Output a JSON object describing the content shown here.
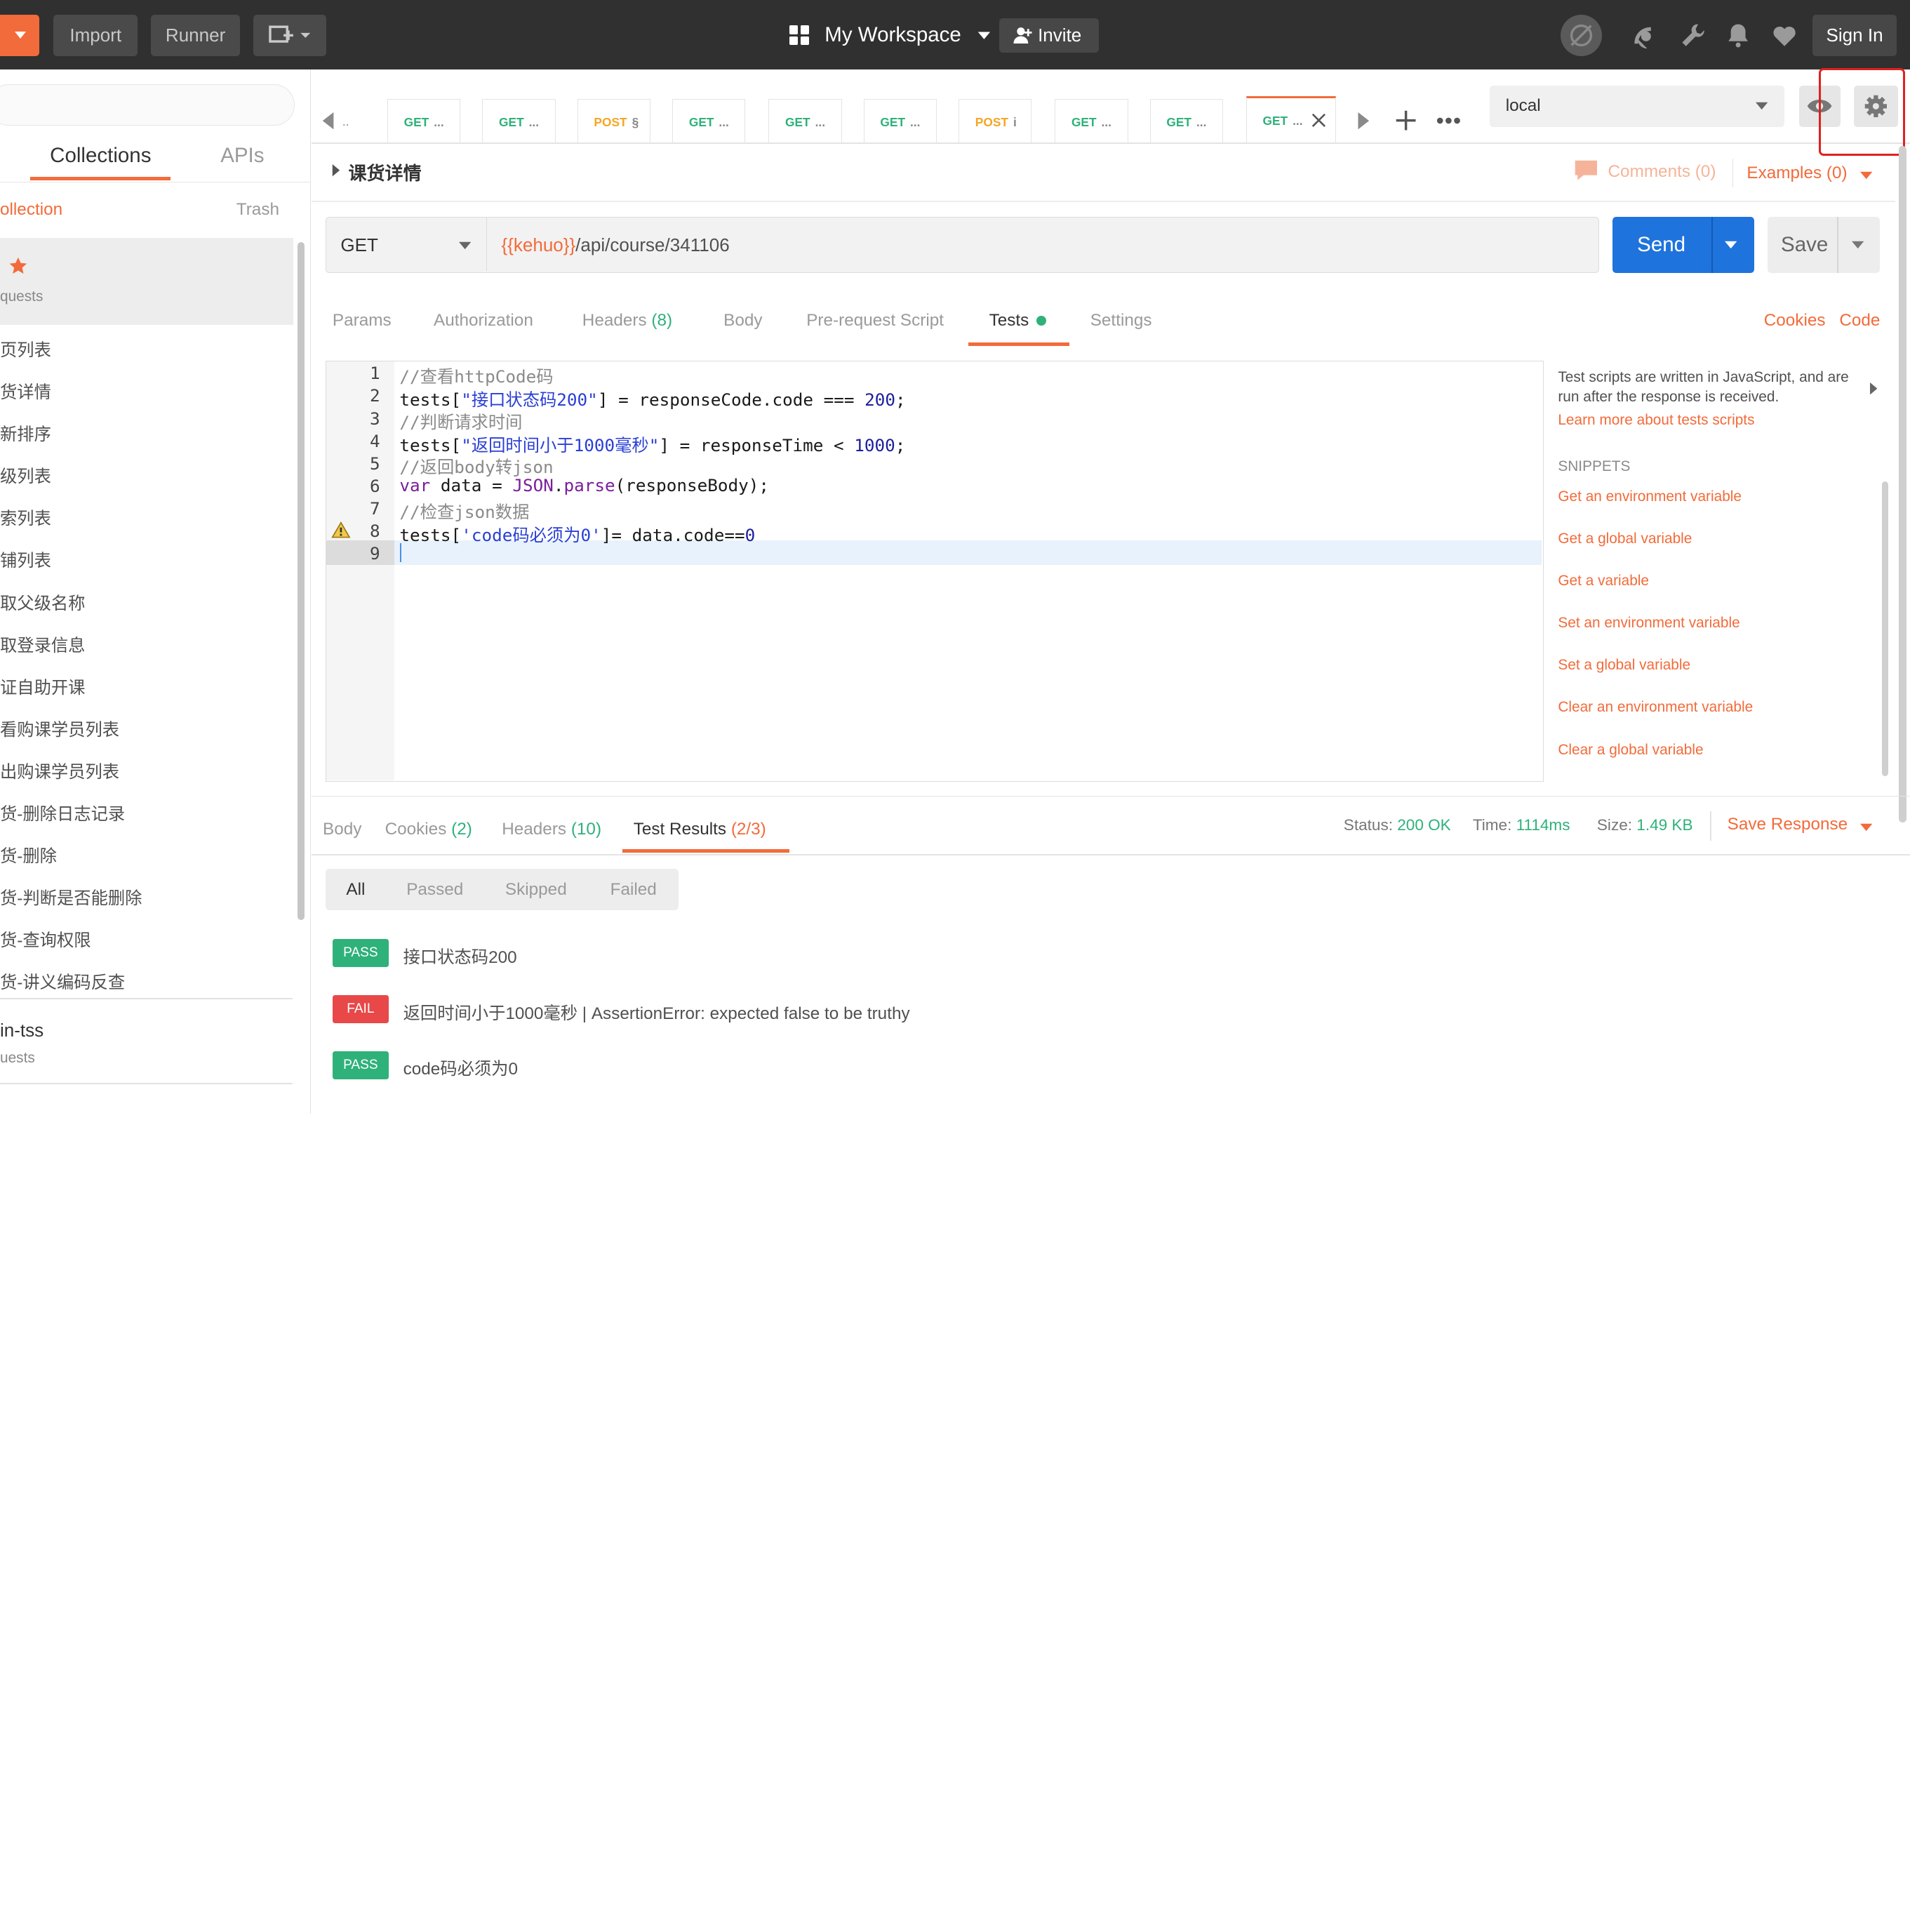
{
  "topbar": {
    "import_label": "Import",
    "runner_label": "Runner",
    "workspace_label": "My Workspace",
    "invite_label": "Invite",
    "signin_label": "Sign In"
  },
  "sidebar": {
    "tabs": [
      "Collections",
      "APIs"
    ],
    "new_collection_label": "ollection",
    "trash_label": "Trash",
    "favorite_sub": "quests",
    "items": [
      "页列表",
      "货详情",
      "新排序",
      "级列表",
      "索列表",
      "铺列表",
      "取父级名称",
      "取登录信息",
      "证自助开课",
      "看购课学员列表",
      "出购课学员列表",
      "货-删除日志记录",
      "货-删除",
      "货-判断是否能删除",
      "货-查询权限",
      "货-讲义编码反查"
    ],
    "group2_title": "in-tss",
    "group2_sub": "uests"
  },
  "tabs": [
    {
      "method": "GET",
      "label": "..."
    },
    {
      "method": "GET",
      "label": "..."
    },
    {
      "method": "POST",
      "label": "§"
    },
    {
      "method": "GET",
      "label": "..."
    },
    {
      "method": "GET",
      "label": "..."
    },
    {
      "method": "GET",
      "label": "..."
    },
    {
      "method": "POST",
      "label": "i"
    },
    {
      "method": "GET",
      "label": "..."
    },
    {
      "method": "GET",
      "label": "..."
    },
    {
      "method": "GET",
      "label": "..."
    }
  ],
  "first_tab_label": "..",
  "environment": {
    "selected": "local"
  },
  "request": {
    "name": "课货详情",
    "comments_label": "Comments (0)",
    "examples_label": "Examples (0)",
    "method": "GET",
    "url_var": "{{kehuo}}",
    "url_path": "/api/course/341106",
    "send_label": "Send",
    "save_label": "Save",
    "tabs": {
      "params": "Params",
      "authorization": "Authorization",
      "headers": "Headers",
      "headers_count": "(8)",
      "body": "Body",
      "prerequest": "Pre-request Script",
      "tests": "Tests",
      "settings": "Settings"
    },
    "cookies_label": "Cookies",
    "code_label": "Code"
  },
  "editor": {
    "lines": [
      "1",
      "2",
      "3",
      "4",
      "5",
      "6",
      "7",
      "8",
      "9"
    ],
    "code": {
      "l1": "//查看httpCode码",
      "l2a": "tests[",
      "l2b": "\"接口状态码200\"",
      "l2c": "] = responseCode.code === ",
      "l2d": "200",
      "l2e": ";",
      "l3": "//判断请求时间",
      "l4a": "tests[",
      "l4b": "\"返回时间小于1000毫秒\"",
      "l4c": "] = responseTime < ",
      "l4d": "1000",
      "l4e": ";",
      "l5": "//返回body转json",
      "l6a": "var",
      "l6b": " data = ",
      "l6c": "JSON",
      "l6d": ".",
      "l6e": "parse",
      "l6f": "(responseBody);",
      "l7": "//检查json数据",
      "l8a": "tests[",
      "l8b": "'code码必须为0'",
      "l8c": "]= data.code==",
      "l8d": "0"
    }
  },
  "snippets_panel": {
    "info": "Test scripts are written in JavaScript, and are run after the response is received.",
    "learn_more": "Learn more about tests scripts",
    "heading": "SNIPPETS",
    "items": [
      "Get an environment variable",
      "Get a global variable",
      "Get a variable",
      "Set an environment variable",
      "Set a global variable",
      "Clear an environment variable",
      "Clear a global variable"
    ]
  },
  "response": {
    "tabs": {
      "body": "Body",
      "cookies": "Cookies",
      "cookies_count": "(2)",
      "headers": "Headers",
      "headers_count": "(10)",
      "test_results": "Test Results",
      "test_results_count": "(2/3)"
    },
    "status_label": "Status:",
    "status_value": "200 OK",
    "time_label": "Time:",
    "time_value": "1114ms",
    "size_label": "Size:",
    "size_value": "1.49 KB",
    "save_response_label": "Save Response",
    "filters": [
      "All",
      "Passed",
      "Skipped",
      "Failed"
    ],
    "results": [
      {
        "status": "PASS",
        "text": "接口状态码200"
      },
      {
        "status": "FAIL",
        "text": "返回时间小于1000毫秒 | AssertionError: expected false to be truthy"
      },
      {
        "status": "PASS",
        "text": "code码必须为0"
      }
    ]
  },
  "colors": {
    "accent": "#f26b3a",
    "send": "#1a73e8",
    "pass": "#2fb17a",
    "fail": "#e84848",
    "highlight": "#e02020"
  }
}
